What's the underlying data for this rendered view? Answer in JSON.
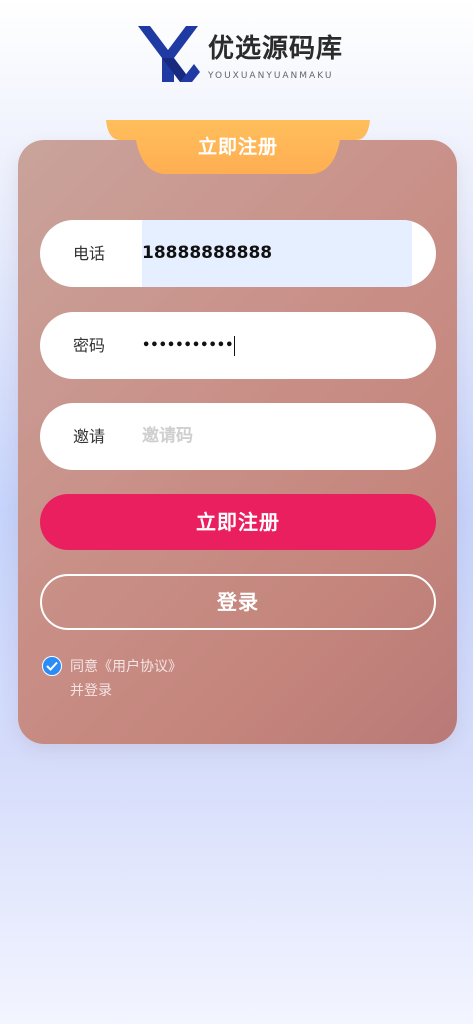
{
  "brand": {
    "name": "优选源码库",
    "subtitle": "YOUXUANYUANMAKU",
    "colors": {
      "primary": "#1f3aa3",
      "dark": "#172a80"
    }
  },
  "tab": {
    "title": "立即注册",
    "color": "#ffb347"
  },
  "form": {
    "phone": {
      "label": "电话",
      "value": "18888888888"
    },
    "password": {
      "label": "密码",
      "value": "•••••••••••"
    },
    "invite": {
      "label": "邀请",
      "placeholder": "邀请码"
    }
  },
  "buttons": {
    "register": "立即注册",
    "login": "登录",
    "register_color": "#e91f5f"
  },
  "agreement": {
    "checked": true,
    "text_line1": "同意《用户协议》",
    "text_line2": "并登录"
  }
}
